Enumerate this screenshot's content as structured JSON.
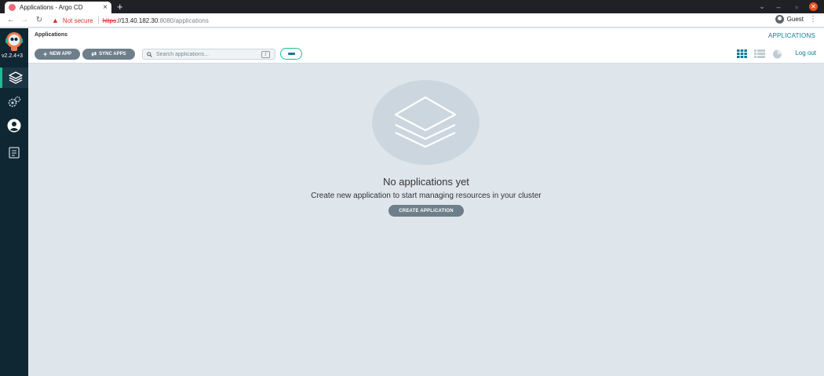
{
  "browser": {
    "tab_title": "Applications - Argo CD",
    "tab_close": "×",
    "new_tab": "+",
    "not_secure": "Not secure",
    "url_scheme": "https",
    "url_host": "://13.40.182.30",
    "url_path": ":8080/applications",
    "profile_name": "Guest",
    "minimize": "–",
    "restore": "▫",
    "close": "✕"
  },
  "sidebar": {
    "version": "v2.2.4+3",
    "items": [
      {
        "name": "applications",
        "icon": "layers-icon",
        "active": true
      },
      {
        "name": "settings",
        "icon": "gears-icon",
        "active": false
      },
      {
        "name": "user-info",
        "icon": "user-circle-icon",
        "active": false
      },
      {
        "name": "documentation",
        "icon": "docs-icon",
        "active": false
      }
    ]
  },
  "header": {
    "title": "Applications",
    "breadcrumb_right": "APPLICATIONS",
    "new_app_label": "NEW APP",
    "sync_apps_label": "SYNC APPS",
    "search_placeholder": "Search applications...",
    "search_shortcut": "/",
    "logout_label": "Log out"
  },
  "empty_state": {
    "title": "No applications yet",
    "subtitle": "Create new application to start managing resources in your cluster",
    "button_label": "CREATE APPLICATION"
  },
  "colors": {
    "accent": "#0d7a95",
    "sidebar_bg": "#0f2733",
    "content_bg": "#dee6eb",
    "button_bg": "#6d7f8b",
    "toggle_border": "#18be94"
  }
}
